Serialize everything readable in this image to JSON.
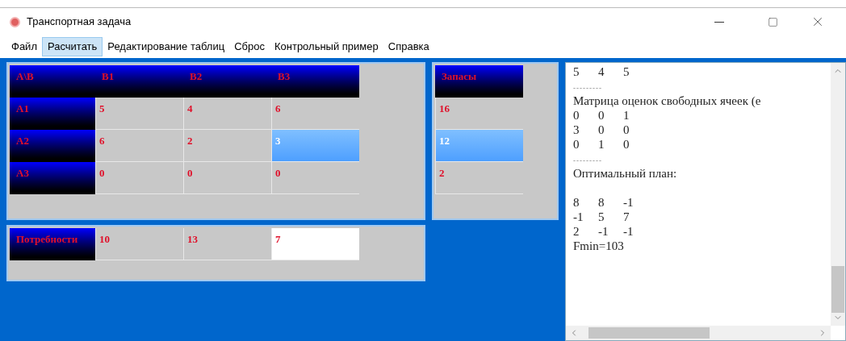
{
  "window": {
    "title": "Транспортная задача"
  },
  "menu": [
    {
      "label": "Файл",
      "selected": false
    },
    {
      "label": "Расчитать",
      "selected": true
    },
    {
      "label": "Редактирование таблиц",
      "selected": false
    },
    {
      "label": "Сброс",
      "selected": false
    },
    {
      "label": "Контрольный пример",
      "selected": false
    },
    {
      "label": "Справка",
      "selected": false
    }
  ],
  "cost_table": {
    "corner": "A\\B",
    "columns": [
      "B1",
      "B2",
      "B3"
    ],
    "rows": [
      {
        "label": "A1",
        "cells": [
          {
            "value": "5",
            "selected": false
          },
          {
            "value": "4",
            "selected": false
          },
          {
            "value": "6",
            "selected": false
          }
        ]
      },
      {
        "label": "A2",
        "cells": [
          {
            "value": "6",
            "selected": false
          },
          {
            "value": "2",
            "selected": false
          },
          {
            "value": "3",
            "selected": true
          }
        ]
      },
      {
        "label": "A3",
        "cells": [
          {
            "value": "0",
            "selected": false
          },
          {
            "value": "0",
            "selected": false
          },
          {
            "value": "0",
            "selected": false
          }
        ]
      }
    ]
  },
  "supplies": {
    "header": "Запасы",
    "cells": [
      {
        "value": "16",
        "selected": false
      },
      {
        "value": "12",
        "selected": true
      },
      {
        "value": "2",
        "selected": false
      }
    ]
  },
  "needs": {
    "label": "Потребности",
    "cells": [
      {
        "value": "10",
        "focused": false
      },
      {
        "value": "13",
        "focused": false
      },
      {
        "value": "7",
        "focused": true
      }
    ]
  },
  "output": [
    {
      "kind": "row",
      "values": [
        "5",
        "4",
        "5"
      ]
    },
    {
      "kind": "rule",
      "text": "---------"
    },
    {
      "kind": "text",
      "text": "Матрица оценок свободных ячеек (е",
      "blank_after": false
    },
    {
      "kind": "row",
      "values": [
        "0",
        "0",
        "1"
      ]
    },
    {
      "kind": "row",
      "values": [
        "3",
        "0",
        "0"
      ]
    },
    {
      "kind": "row",
      "values": [
        "0",
        "1",
        "0"
      ]
    },
    {
      "kind": "rule",
      "text": "---------"
    },
    {
      "kind": "text",
      "text": "Оптимальный план:",
      "blank_after": true
    },
    {
      "kind": "row",
      "values": [
        "8",
        "8",
        "-1"
      ]
    },
    {
      "kind": "row",
      "values": [
        "-1",
        "5",
        "7"
      ]
    },
    {
      "kind": "row",
      "values": [
        "2",
        "-1",
        "-1"
      ]
    },
    {
      "kind": "text",
      "text": "Fmin=103",
      "blank_after": false
    }
  ]
}
